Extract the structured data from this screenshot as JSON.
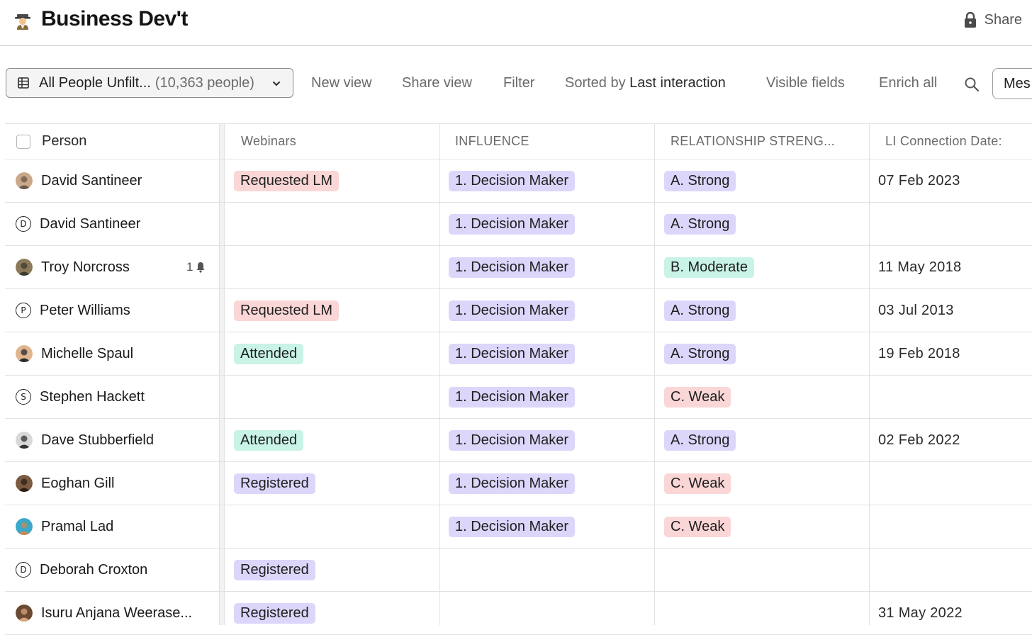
{
  "header": {
    "title": "Business Dev't",
    "share_label": "Share"
  },
  "toolbar": {
    "view_name": "All People Unfilt...",
    "view_count": "(10,363 people)",
    "new_view": "New view",
    "share_view": "Share view",
    "filter": "Filter",
    "sorted_prefix": "Sorted by",
    "sorted_field": "Last interaction",
    "visible_fields": "Visible fields",
    "enrich_all": "Enrich all",
    "message_button": "Mes"
  },
  "colors": {
    "pink": "#fad6d6",
    "green": "#c8f3e6",
    "purple": "#dcd6fb"
  },
  "table": {
    "columns": [
      "Person",
      "Webinars",
      "INFLUENCE",
      "RELATIONSHIP STRENG...",
      "LI Connection Date:"
    ],
    "rows": [
      {
        "name": "David Santineer",
        "avatar": "photo",
        "webinar": "Requested LM",
        "webinar_color": "pink",
        "influence": "1. Decision Maker",
        "strength": "A. Strong",
        "strength_color": "purple",
        "date": "07 Feb 2023"
      },
      {
        "name": "David Santineer",
        "avatar": "D",
        "webinar": "",
        "influence": "1. Decision Maker",
        "strength": "A. Strong",
        "strength_color": "purple",
        "date": ""
      },
      {
        "name": "Troy Norcross",
        "avatar": "photo",
        "notif_count": "1",
        "webinar": "",
        "influence": "1. Decision Maker",
        "strength": "B. Moderate",
        "strength_color": "green",
        "date": "11 May 2018"
      },
      {
        "name": "Peter Williams",
        "avatar": "P",
        "webinar": "Requested LM",
        "webinar_color": "pink",
        "influence": "1. Decision Maker",
        "strength": "A. Strong",
        "strength_color": "purple",
        "date": "03 Jul 2013"
      },
      {
        "name": "Michelle Spaul",
        "avatar": "photo",
        "webinar": "Attended",
        "webinar_color": "green",
        "influence": "1. Decision Maker",
        "strength": "A. Strong",
        "strength_color": "purple",
        "date": "19 Feb 2018"
      },
      {
        "name": "Stephen Hackett",
        "avatar": "S",
        "webinar": "",
        "influence": "1. Decision Maker",
        "strength": "C. Weak",
        "strength_color": "pink",
        "date": ""
      },
      {
        "name": "Dave Stubberfield",
        "avatar": "photo",
        "webinar": "Attended",
        "webinar_color": "green",
        "influence": "1. Decision Maker",
        "strength": "A. Strong",
        "strength_color": "purple",
        "date": "02 Feb 2022"
      },
      {
        "name": "Eoghan Gill",
        "avatar": "photo",
        "webinar": "Registered",
        "webinar_color": "purple",
        "influence": "1. Decision Maker",
        "strength": "C. Weak",
        "strength_color": "pink",
        "date": ""
      },
      {
        "name": "Pramal Lad",
        "avatar": "photo",
        "webinar": "",
        "influence": "1. Decision Maker",
        "strength": "C. Weak",
        "strength_color": "pink",
        "date": ""
      },
      {
        "name": "Deborah Croxton",
        "avatar": "D",
        "webinar": "Registered",
        "webinar_color": "purple",
        "influence": "",
        "strength": "",
        "date": ""
      },
      {
        "name": "Isuru Anjana Weerase...",
        "avatar": "photo",
        "webinar": "Registered",
        "webinar_color": "purple",
        "influence": "",
        "strength": "",
        "date": "31 May 2022"
      }
    ]
  }
}
